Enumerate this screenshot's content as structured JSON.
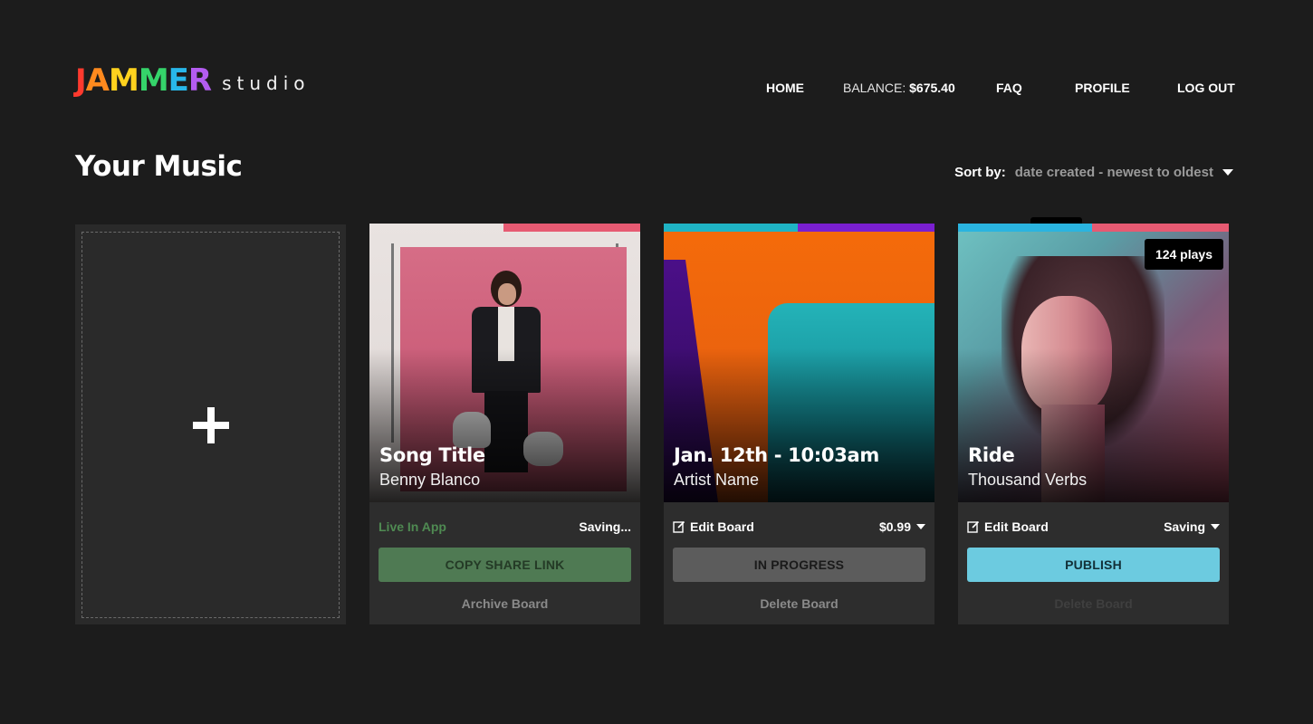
{
  "brand": {
    "letters": [
      {
        "char": "J",
        "color": "#ff3a2e"
      },
      {
        "char": "A",
        "color": "#ff8a1e"
      },
      {
        "char": "M",
        "color": "#ffd21e"
      },
      {
        "char": "M",
        "color": "#35d46a"
      },
      {
        "char": "E",
        "color": "#28b7ea"
      },
      {
        "char": "R",
        "color": "#b35cf0"
      }
    ],
    "subtitle": "studio"
  },
  "nav": {
    "home": "HOME",
    "balance_label": "BALANCE:",
    "balance_value": "$675.40",
    "faq": "FAQ",
    "profile": "PROFILE",
    "logout": "LOG OUT"
  },
  "page": {
    "title": "Your Music",
    "sort_label": "Sort by:",
    "sort_value": "date created - newest to oldest"
  },
  "cards": [
    {
      "title": "Song Title",
      "artist": "Benny Blanco",
      "status": "Live In App",
      "state": "Saving...",
      "button": "COPY SHARE LINK",
      "link": "Archive Board",
      "stripe_colors": [
        "#ffffff00",
        "#e65a72"
      ]
    },
    {
      "title": "Jan. 12th - 10:03am",
      "artist": "Artist Name",
      "edit": "Edit Board",
      "price": "$0.99",
      "button": "IN PROGRESS",
      "link": "Delete Board",
      "stripe_colors": [
        "#1fb3c4",
        "#7a1fd0"
      ]
    },
    {
      "title": "Ride",
      "artist": "Thousand Verbs",
      "plays": "124 plays",
      "edit": "Edit Board",
      "state": "Saving",
      "button": "PUBLISH",
      "link": "Delete Board",
      "stripe_colors": [
        "#2ab4e0",
        "#e65a72"
      ]
    }
  ]
}
